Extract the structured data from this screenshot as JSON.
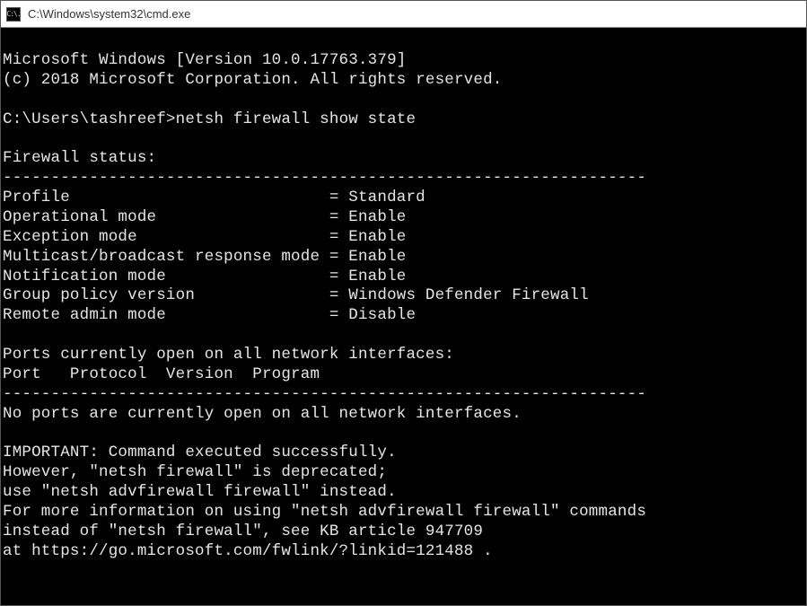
{
  "window": {
    "title": "C:\\Windows\\system32\\cmd.exe",
    "icon_text": "C:\\."
  },
  "banner": {
    "line1": "Microsoft Windows [Version 10.0.17763.379]",
    "line2": "(c) 2018 Microsoft Corporation. All rights reserved."
  },
  "prompt": {
    "path": "C:\\Users\\tashreef>",
    "command": "netsh firewall show state"
  },
  "firewall": {
    "header": "Firewall status:",
    "rule": "-------------------------------------------------------------------",
    "rows": [
      {
        "key": "Profile",
        "value": "Standard"
      },
      {
        "key": "Operational mode",
        "value": "Enable"
      },
      {
        "key": "Exception mode",
        "value": "Enable"
      },
      {
        "key": "Multicast/broadcast response mode",
        "value": "Enable"
      },
      {
        "key": "Notification mode",
        "value": "Enable"
      },
      {
        "key": "Group policy version",
        "value": "Windows Defender Firewall"
      },
      {
        "key": "Remote admin mode",
        "value": "Disable"
      }
    ]
  },
  "ports": {
    "heading": "Ports currently open on all network interfaces:",
    "columns": "Port   Protocol  Version  Program",
    "rule": "-------------------------------------------------------------------",
    "none": "No ports are currently open on all network interfaces."
  },
  "important": {
    "l1": "IMPORTANT: Command executed successfully.",
    "l2": "However, \"netsh firewall\" is deprecated;",
    "l3": "use \"netsh advfirewall firewall\" instead.",
    "l4": "For more information on using \"netsh advfirewall firewall\" commands",
    "l5": "instead of \"netsh firewall\", see KB article 947709",
    "l6": "at https://go.microsoft.com/fwlink/?linkid=121488 ."
  }
}
